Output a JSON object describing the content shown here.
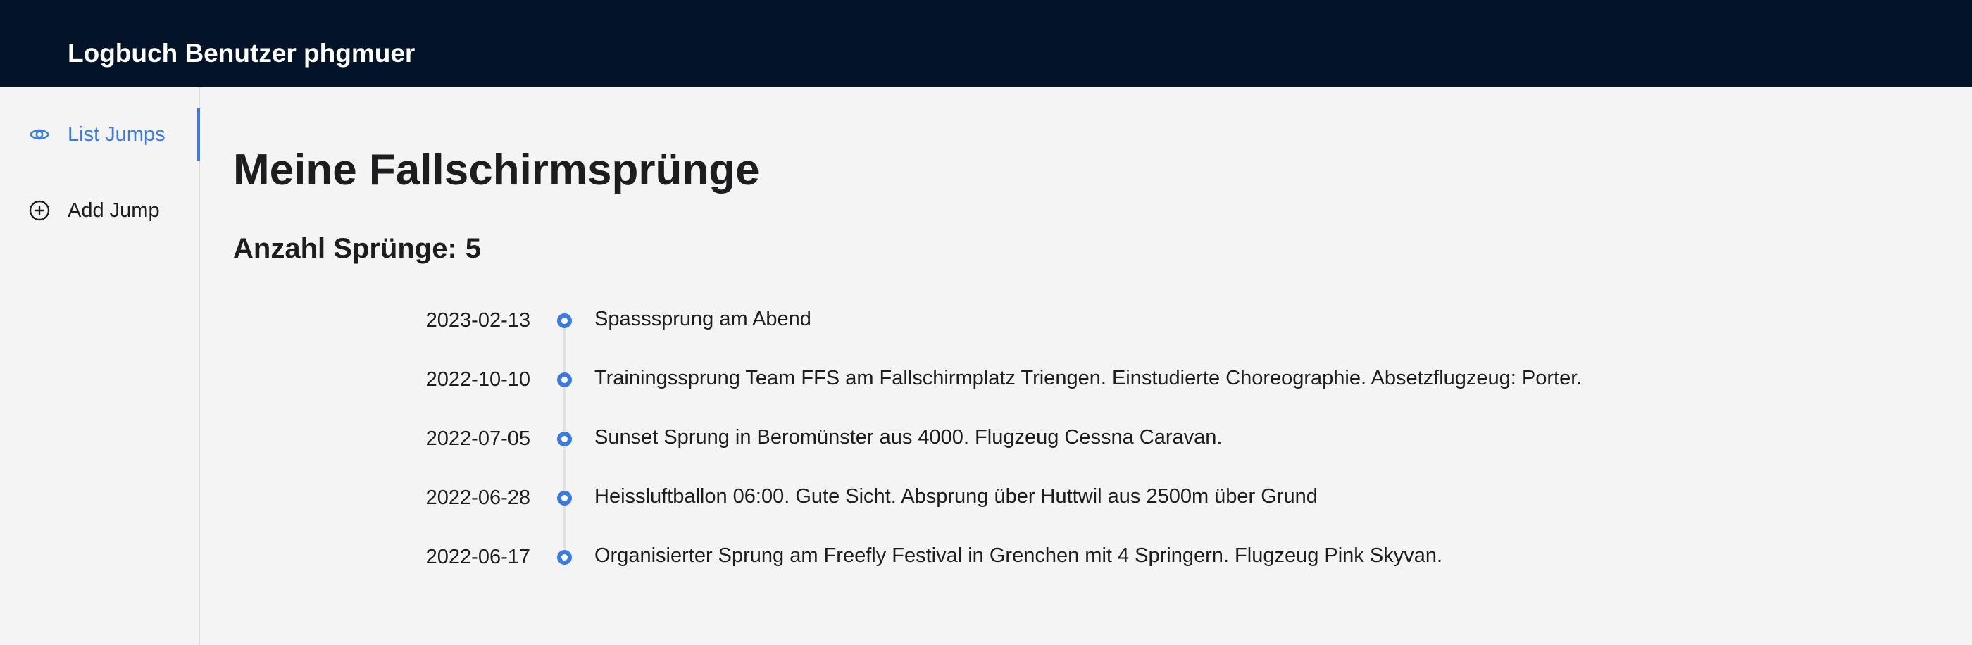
{
  "header": {
    "title": "Logbuch Benutzer phgmuer",
    "background_color": "#041428"
  },
  "sidebar": {
    "items": [
      {
        "label": "List Jumps",
        "icon": "eye-icon",
        "active": true
      },
      {
        "label": "Add Jump",
        "icon": "plus-circle-icon",
        "active": false
      }
    ],
    "accent_color": "#3b7be0"
  },
  "main": {
    "title": "Meine Fallschirmsprünge",
    "count_label": "Anzahl Sprünge:",
    "count_value": "5",
    "jumps": [
      {
        "date": "2023-02-13",
        "description": "Spasssprung am Abend"
      },
      {
        "date": "2022-10-10",
        "description": "Trainingssprung Team FFS am Fallschirmplatz Triengen. Einstudierte Choreographie. Absetzflugzeug: Porter."
      },
      {
        "date": "2022-07-05",
        "description": "Sunset Sprung in Beromünster aus 4000. Flugzeug Cessna Caravan."
      },
      {
        "date": "2022-06-28",
        "description": "Heissluftballon 06:00. Gute Sicht. Absprung über Huttwil aus 2500m über Grund"
      },
      {
        "date": "2022-06-17",
        "description": "Organisierter Sprung am Freefly Festival in Grenchen mit 4 Springern. Flugzeug Pink Skyvan."
      }
    ]
  }
}
